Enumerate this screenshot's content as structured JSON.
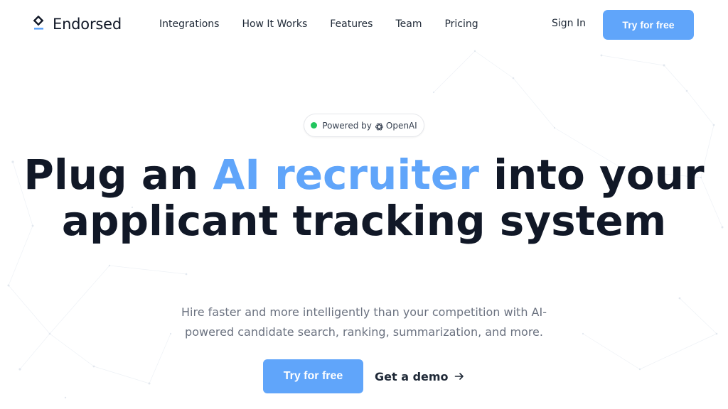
{
  "nav": {
    "brand": "Endorsed",
    "links": [
      "Integrations",
      "How It Works",
      "Features",
      "Team",
      "Pricing"
    ],
    "sign_in": "Sign In",
    "cta": "Try for free"
  },
  "badge": {
    "prefix": "Powered by",
    "brand": "OpenAI"
  },
  "hero": {
    "title_pre": "Plug an ",
    "title_accent": "AI recruiter",
    "title_post": " into your applicant tracking system",
    "subtitle": "Hire faster and more intelligently than your competition with AI-powered candidate search, ranking, summarization, and more.",
    "primary_cta": "Try for free",
    "secondary_cta": "Get a demo"
  },
  "colors": {
    "accent": "#60a5fa",
    "text": "#111827",
    "muted": "#6b7280",
    "status_dot": "#22c55e"
  },
  "icons": {
    "logo": "diamond-logo-icon",
    "badge": "openai-icon",
    "demo": "arrow-right-icon"
  }
}
